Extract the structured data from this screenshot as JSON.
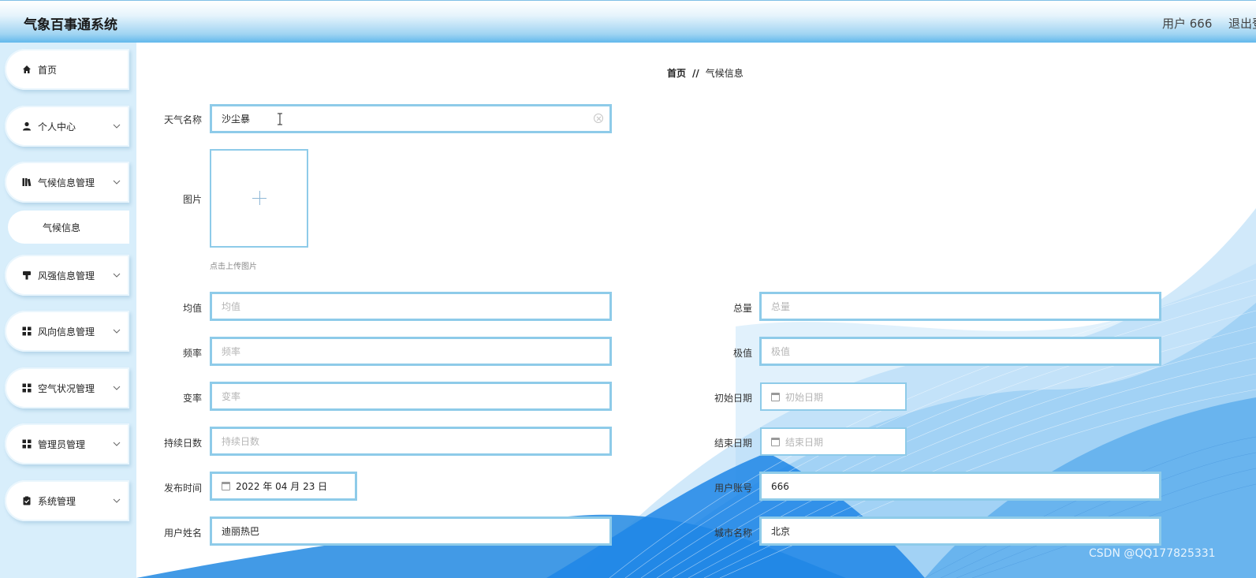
{
  "app": {
    "title": "气象百事通系统",
    "user_label": "用户 666",
    "logout_label": "退出登录"
  },
  "sidebar": {
    "items": [
      {
        "label": "首页"
      },
      {
        "label": "个人中心"
      },
      {
        "label": "气候信息管理"
      },
      {
        "label": "风强信息管理"
      },
      {
        "label": "风向信息管理"
      },
      {
        "label": "空气状况管理"
      },
      {
        "label": "管理员管理"
      },
      {
        "label": "系统管理"
      }
    ],
    "subitem": {
      "label": "气候信息"
    }
  },
  "breadcrumb": {
    "home": "首页",
    "separator": "//",
    "current": "气候信息"
  },
  "form": {
    "weather_name": {
      "label": "天气名称",
      "value": "沙尘暴"
    },
    "image": {
      "label": "图片",
      "hint": "点击上传图片"
    },
    "mean": {
      "label": "均值",
      "placeholder": "均值"
    },
    "total": {
      "label": "总量",
      "placeholder": "总量"
    },
    "frequency": {
      "label": "频率",
      "placeholder": "频率"
    },
    "extreme": {
      "label": "极值",
      "placeholder": "极值"
    },
    "variability": {
      "label": "变率",
      "placeholder": "变率"
    },
    "start_date": {
      "label": "初始日期",
      "placeholder": "初始日期"
    },
    "duration_days": {
      "label": "持续日数",
      "placeholder": "持续日数"
    },
    "end_date": {
      "label": "结束日期",
      "placeholder": "结束日期"
    },
    "publish_time": {
      "label": "发布时间",
      "value": "2022 年 04 月 23 日"
    },
    "user_account": {
      "label": "用户账号",
      "value": "666"
    },
    "user_name": {
      "label": "用户姓名",
      "value": "迪丽热巴"
    },
    "city_name": {
      "label": "城市名称",
      "value": "北京"
    }
  },
  "watermark": "CSDN @QQ177825331",
  "colors": {
    "accent": "#62b8ec",
    "field_border": "#8ecbe9",
    "sidebar_bg": "#d8eefb"
  }
}
